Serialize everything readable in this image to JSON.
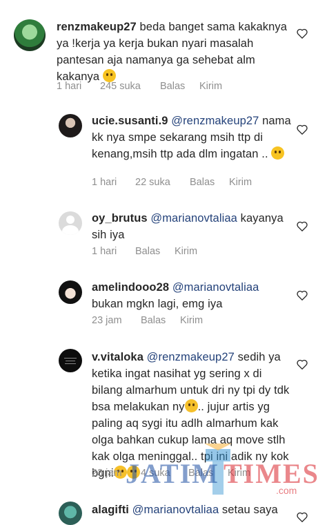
{
  "comments": [
    {
      "username": "renzmakeup27",
      "mention": "",
      "body": "beda banget sama kakaknya ya !kerja ya kerja bukan nyari masalah pantesan aja namanya ga sehebat alm kakanya",
      "time": "1 hari",
      "likes": "245 suka",
      "reply": "Balas",
      "send": "Kirim"
    },
    {
      "username": "ucie.susanti.9",
      "mention": "@renzmakeup27",
      "body": "nama kk nya smpe sekarang msih ttp di kenang,msih ttp ada dlm ingatan ..",
      "time": "1 hari",
      "likes": "22 suka",
      "reply": "Balas",
      "send": "Kirim"
    },
    {
      "username": "oy_brutus",
      "mention": "@marianovtaliaa",
      "body": "kayanya sih iya",
      "time": "1 hari",
      "likes": "",
      "reply": "Balas",
      "send": "Kirim"
    },
    {
      "username": "amelindooo28",
      "mention": "@marianovtaliaa",
      "body": "bukan mgkn lagi, emg iya",
      "time": "23 jam",
      "likes": "",
      "reply": "Balas",
      "send": "Kirim"
    },
    {
      "username": "v.vitaloka",
      "mention": "@renzmakeup27",
      "body": "sedih ya ketika ingat nasihat yg sering x di bilang almarhum untuk dri ny tpi dy tdk bsa melakukan ny",
      "body2": ".. jujur artis yg paling aq sygi itu adlh almarhum kak olga bahkan cukup lama aq move stlh kak olga meninggal.. tpi ini adik ny kok bgni",
      "time": "23 jam",
      "likes": "4 suka",
      "reply": "Balas",
      "send": "Kirim"
    },
    {
      "username": "alagifti",
      "mention": "@marianovtaliaa",
      "body": "setau saya",
      "time": "",
      "likes": "",
      "reply": "",
      "send": ""
    }
  ],
  "watermark": {
    "word1": "JATIM",
    "word2": "TIMES",
    "domain": ".com"
  },
  "colors": {
    "mention": "#24427a",
    "meta": "#8e8e8e",
    "text": "#262626",
    "watermark_red": "#d9262e",
    "watermark_blue": "#1e4fa3"
  },
  "icons": [
    "heart-icon",
    "emoji-icon"
  ]
}
